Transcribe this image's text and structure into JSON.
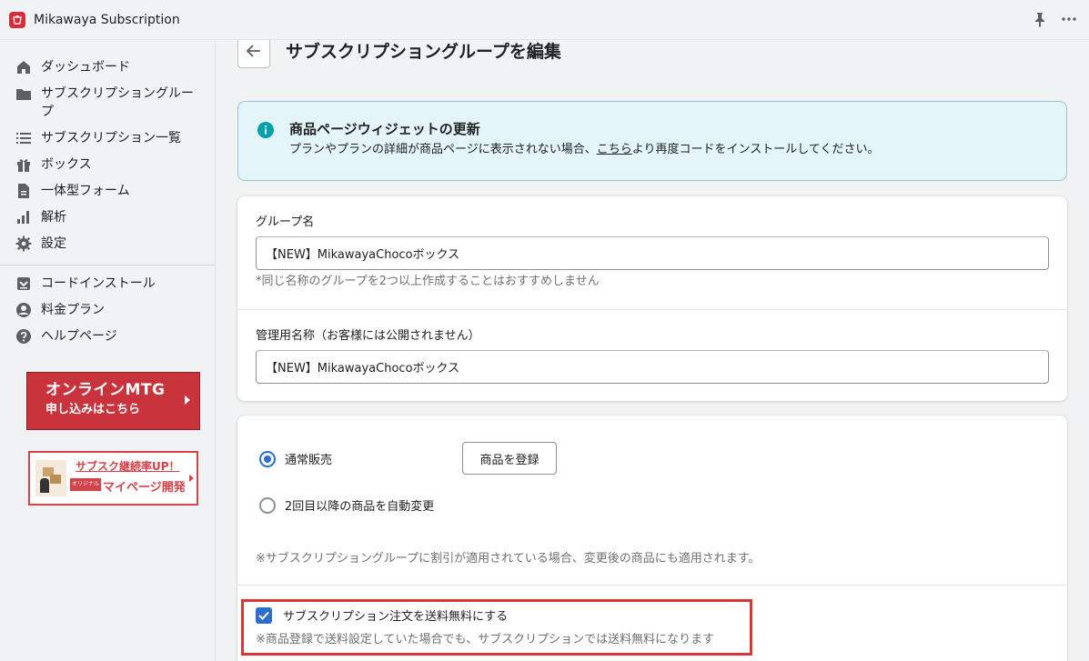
{
  "app": {
    "title": "Mikawaya Subscription"
  },
  "sidebar": {
    "items": [
      {
        "label": "ダッシュボード",
        "icon": "home-icon"
      },
      {
        "label": "サブスクリプショングループ",
        "icon": "folder-icon"
      },
      {
        "label": "サブスクリプション一覧",
        "icon": "list-icon"
      },
      {
        "label": "ボックス",
        "icon": "gift-icon"
      },
      {
        "label": "一体型フォーム",
        "icon": "document-icon"
      },
      {
        "label": "解析",
        "icon": "bar-chart-icon"
      },
      {
        "label": "設定",
        "icon": "gear-icon"
      }
    ],
    "secondary_items": [
      {
        "label": "コードインストール",
        "icon": "install-icon"
      },
      {
        "label": "料金プラン",
        "icon": "user-circle-icon"
      },
      {
        "label": "ヘルプページ",
        "icon": "help-icon"
      }
    ],
    "banner_mtg": {
      "line1": "オンラインMTG",
      "line2": "申し込みはこちら"
    },
    "banner_sub": {
      "line1": "サブスク継続率UP！",
      "tag": "オリジナル",
      "line2": "マイページ開発"
    }
  },
  "page": {
    "title": "サブスクリプショングループを編集"
  },
  "info_banner": {
    "title": "商品ページウィジェットの更新",
    "text_before": "プランやプランの詳細が商品ページに表示されない場合、",
    "link": "こちら",
    "text_after": "より再度コードをインストールしてください。"
  },
  "form": {
    "group_name_label": "グループ名",
    "group_name_value": "【NEW】MikawayaChocoボックス",
    "group_name_help": "*同じ名称のグループを2つ以上作成することはおすすめしません",
    "admin_name_label": "管理用名称（お客様には公開されません）",
    "admin_name_value": "【NEW】MikawayaChocoボックス",
    "radio_normal": "通常販売",
    "register_button": "商品を登録",
    "radio_auto": "2回目以降の商品を自動変更",
    "discount_note": "※サブスクリプショングループに割引が適用されている場合、変更後の商品にも適用されます。",
    "free_shipping_label": "サブスクリプション注文を送料無料にする",
    "free_shipping_help": "※商品登録で送料設定していた場合でも、サブスクリプションでは送料無料になります"
  },
  "colors": {
    "accent": "#2c6ecb",
    "brand": "#d42e3a",
    "highlight": "#d93636",
    "info_bg": "#e3f5f8"
  }
}
